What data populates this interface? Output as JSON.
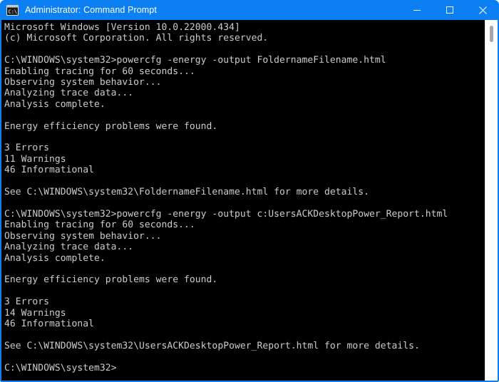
{
  "window": {
    "title": "Administrator: Command Prompt",
    "icon": "command-prompt-icon",
    "accent_color": "#0c7ff2",
    "console_background": "#000000",
    "console_foreground": "#cccccc",
    "controls": {
      "minimize": "–",
      "maximize": "□",
      "close": "✕"
    }
  },
  "scrollbar": {
    "orientation": "vertical",
    "thumb_position_percent": 1
  },
  "console": {
    "prompt": "C:\\WINDOWS\\system32>",
    "lines": [
      "Microsoft Windows [Version 10.0.22000.434]",
      "(c) Microsoft Corporation. All rights reserved.",
      "",
      "C:\\WINDOWS\\system32>powercfg -energy -output FoldernameFilename.html",
      "Enabling tracing for 60 seconds...",
      "Observing system behavior...",
      "Analyzing trace data...",
      "Analysis complete.",
      "",
      "Energy efficiency problems were found.",
      "",
      "3 Errors",
      "11 Warnings",
      "46 Informational",
      "",
      "See C:\\WINDOWS\\system32\\FoldernameFilename.html for more details.",
      "",
      "C:\\WINDOWS\\system32>powercfg -energy -output c:UsersACKDesktopPower_Report.html",
      "Enabling tracing for 60 seconds...",
      "Observing system behavior...",
      "Analyzing trace data...",
      "Analysis complete.",
      "",
      "Energy efficiency problems were found.",
      "",
      "3 Errors",
      "14 Warnings",
      "46 Informational",
      "",
      "See C:\\WINDOWS\\system32\\UsersACKDesktopPower_Report.html for more details.",
      "",
      "C:\\WINDOWS\\system32>"
    ],
    "text": "Microsoft Windows [Version 10.0.22000.434]\n(c) Microsoft Corporation. All rights reserved.\n\nC:\\WINDOWS\\system32>powercfg -energy -output FoldernameFilename.html\nEnabling tracing for 60 seconds...\nObserving system behavior...\nAnalyzing trace data...\nAnalysis complete.\n\nEnergy efficiency problems were found.\n\n3 Errors\n11 Warnings\n46 Informational\n\nSee C:\\WINDOWS\\system32\\FoldernameFilename.html for more details.\n\nC:\\WINDOWS\\system32>powercfg -energy -output c:UsersACKDesktopPower_Report.html\nEnabling tracing for 60 seconds...\nObserving system behavior...\nAnalyzing trace data...\nAnalysis complete.\n\nEnergy efficiency problems were found.\n\n3 Errors\n14 Warnings\n46 Informational\n\nSee C:\\WINDOWS\\system32\\UsersACKDesktopPower_Report.html for more details.\n\nC:\\WINDOWS\\system32>"
  }
}
